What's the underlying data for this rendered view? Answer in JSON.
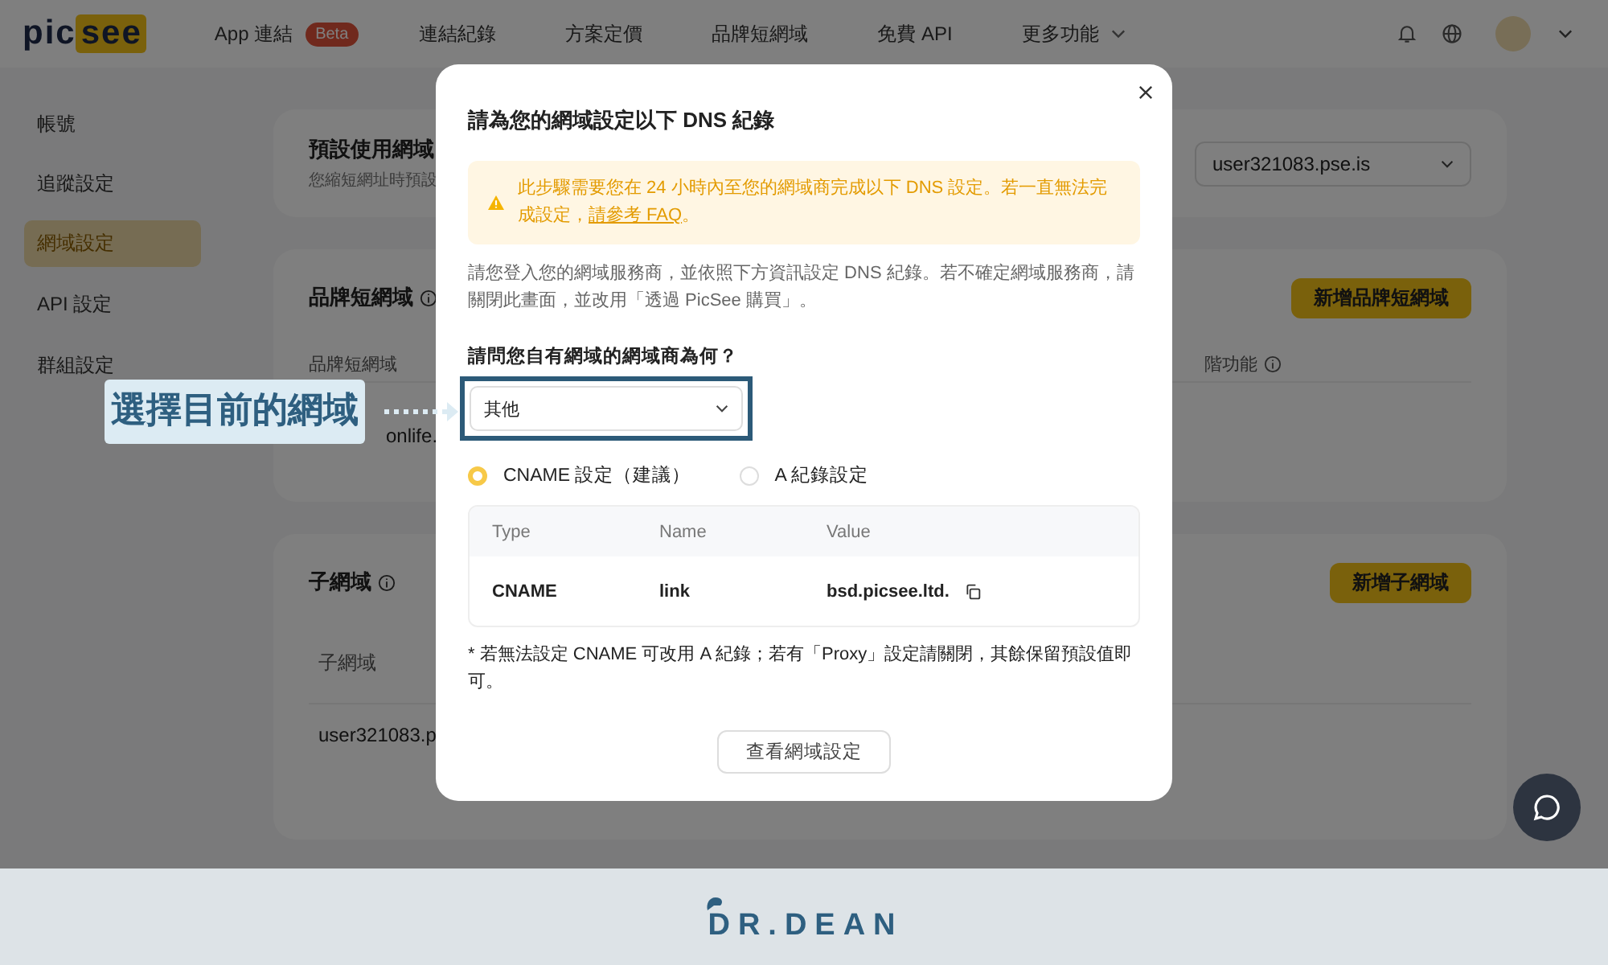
{
  "header": {
    "logo_left": "pic",
    "logo_right": "see",
    "nav": [
      {
        "label": "App 連結",
        "badge": "Beta"
      },
      {
        "label": "連結紀錄"
      },
      {
        "label": "方案定價"
      },
      {
        "label": "品牌短網域"
      },
      {
        "label": "免費 API"
      },
      {
        "label": "更多功能",
        "dropdown": true
      }
    ]
  },
  "sidebar": {
    "items": [
      {
        "label": "帳號",
        "selected": false
      },
      {
        "label": "追蹤設定",
        "selected": false
      },
      {
        "label": "網域設定",
        "selected": true
      },
      {
        "label": "API 設定",
        "selected": false
      },
      {
        "label": "群組設定",
        "selected": false
      }
    ]
  },
  "default_domain": {
    "title": "預設使用網域",
    "subtitle": "您縮短網址時預設",
    "select_value": "user321083.pse.is"
  },
  "brand_domain": {
    "title": "品牌短網域",
    "button": "新增品牌短網域",
    "column_1": "品牌短網域",
    "column_2": "階功能",
    "value": "onlife."
  },
  "subdomain": {
    "title": "子網域",
    "button": "新增子網域",
    "column_1": "子網域",
    "value": "user321083.p"
  },
  "modal": {
    "title": "請為您的網域設定以下 DNS 紀錄",
    "warning": {
      "text": "此步驟需要您在 24 小時內至您的網域商完成以下 DNS 設定。若一直無法完成設定，",
      "link": "請參考 FAQ",
      "after": "。"
    },
    "description": "請您登入您的網域服務商，並依照下方資訊設定 DNS 紀錄。若不確定網域服務商，請關閉此畫面，並改用「透過 PicSee 購買」。",
    "question": "請問您自有網域的網域商為何？",
    "provider_value": "其他",
    "record_options": [
      {
        "label": "CNAME 設定（建議）",
        "selected": true
      },
      {
        "label": "A 紀錄設定",
        "selected": false
      }
    ],
    "table": {
      "columns": [
        "Type",
        "Name",
        "Value"
      ],
      "rows": [
        [
          "CNAME",
          "link",
          "bsd.picsee.ltd."
        ]
      ]
    },
    "note": "* 若無法設定 CNAME 可改用 A 紀錄；若有「Proxy」設定請關閉，其餘保留預設值即可。",
    "button": "查看網域設定"
  },
  "annotation": {
    "text": "選擇目前的網域"
  },
  "footer": {
    "brand": "DR.DEAN"
  }
}
